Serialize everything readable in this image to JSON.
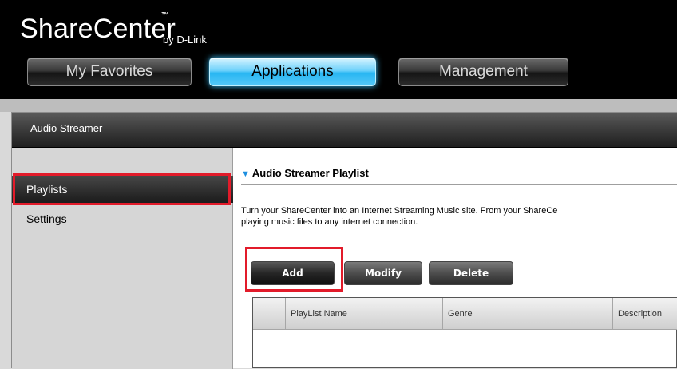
{
  "brand": {
    "name": "ShareCenter",
    "tm": "™",
    "by": "by D-Link"
  },
  "nav": {
    "tabs": [
      {
        "label": "My Favorites",
        "active": false
      },
      {
        "label": "Applications",
        "active": true
      },
      {
        "label": "Management",
        "active": false
      }
    ]
  },
  "panel": {
    "title": "Audio Streamer"
  },
  "sidebar": {
    "items": [
      {
        "label": "Playlists",
        "selected": true
      },
      {
        "label": "Settings",
        "selected": false
      }
    ]
  },
  "content": {
    "section_title": "Audio Streamer Playlist",
    "description_line1": "Turn your ShareCenter into an Internet Streaming Music site. From your ShareCe",
    "description_line2": "playing music files to any internet connection.",
    "buttons": {
      "add": "Add",
      "modify": "Modify",
      "delete": "Delete"
    },
    "table": {
      "columns": [
        "",
        "PlayList Name",
        "Genre",
        "Description"
      ]
    }
  },
  "colors": {
    "accent": "#28b6f2",
    "highlight": "#e21b2a",
    "section_icon": "#1e8fe0"
  }
}
